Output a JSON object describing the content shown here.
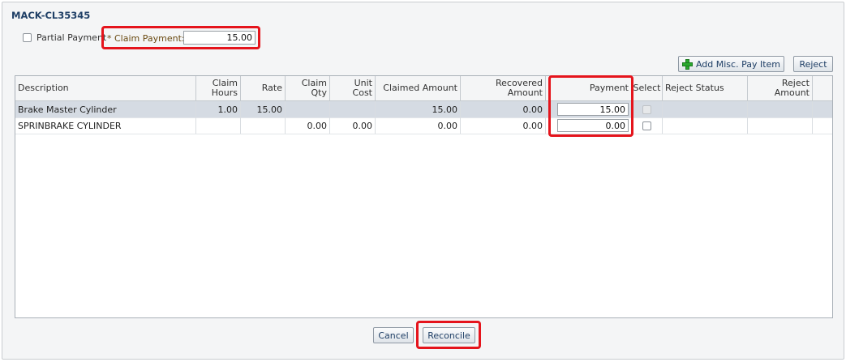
{
  "dialog": {
    "title": "MACK-CL35345",
    "partial_payment_label": "Partial Payment",
    "claim_payment_label": "* Claim Payment:",
    "claim_payment_value": "15.00"
  },
  "toolbar": {
    "add_misc_label": "Add Misc. Pay Item",
    "reject_label": "Reject"
  },
  "table": {
    "headers": {
      "description": "Description",
      "claim_hours_1": "Claim",
      "claim_hours_2": "Hours",
      "rate": "Rate",
      "claim_qty": "Claim Qty",
      "unit_cost": "Unit Cost",
      "claimed_amount": "Claimed Amount",
      "recovered_amount": "Recovered Amount",
      "payment": "Payment",
      "select": "Select",
      "reject_status": "Reject Status",
      "reject_amount": "Reject Amount"
    },
    "rows": [
      {
        "description": "Brake Master Cylinder",
        "claim_hours": "1.00",
        "rate": "15.00",
        "claim_qty": "",
        "unit_cost": "",
        "claimed_amount": "15.00",
        "recovered_amount": "0.00",
        "payment": "15.00",
        "reject_status": "",
        "reject_amount": ""
      },
      {
        "description": "SPRINBRAKE CYLINDER",
        "claim_hours": "",
        "rate": "",
        "claim_qty": "0.00",
        "unit_cost": "0.00",
        "claimed_amount": "0.00",
        "recovered_amount": "0.00",
        "payment": "0.00",
        "reject_status": "",
        "reject_amount": ""
      }
    ]
  },
  "footer": {
    "cancel_label": "Cancel",
    "reconcile_label": "Reconcile"
  },
  "colors": {
    "highlight": "#e5141c",
    "title": "#1f3f66",
    "selected_row": "#d5dbe3"
  }
}
